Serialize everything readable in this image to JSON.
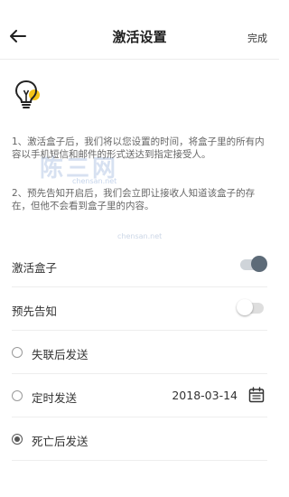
{
  "header": {
    "title": "激活设置",
    "done_label": "完成"
  },
  "icons": {
    "back": "arrow-left-icon",
    "bulb": "lightbulb-icon",
    "calendar": "calendar-icon"
  },
  "description": {
    "p1": "1、激活盒子后，我们将以您设置的时间，将盒子里的所有内容以手机短信和邮件的形式送达到指定接受人。",
    "p2": "2、预先告知开启后，我们会立即让接收人知道该盒子的存在，但他不会看到盒子里的内容。"
  },
  "watermark": {
    "main": "陈三网",
    "sub": "chensan.net",
    "sub2": "chensan.net"
  },
  "settings": {
    "activate_box": {
      "label": "激活盒子",
      "enabled": true
    },
    "pre_notify": {
      "label": "预先告知",
      "enabled": false
    }
  },
  "send_options": {
    "after_lost_contact": {
      "label": "失联后发送",
      "selected": false
    },
    "scheduled": {
      "label": "定时发送",
      "selected": false,
      "date": "2018-03-14"
    },
    "after_death": {
      "label": "死亡后发送",
      "selected": true
    }
  },
  "colors": {
    "toggle_on_knob": "#5d6b78",
    "bulb_accent": "#f5c518"
  }
}
